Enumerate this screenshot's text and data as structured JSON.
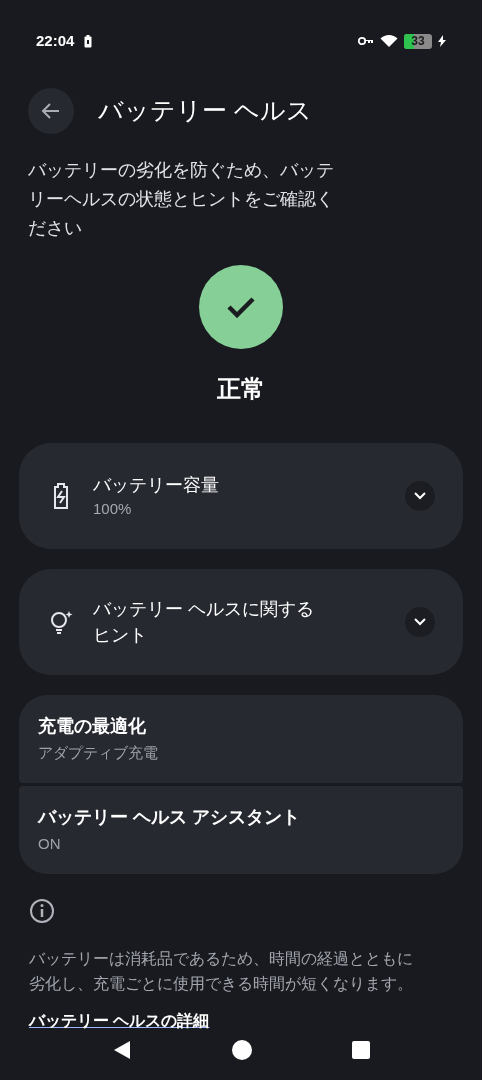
{
  "status_bar": {
    "time": "22:04",
    "battery": "33"
  },
  "header": {
    "title": "バッテリー ヘルス"
  },
  "description": "バッテリーの劣化を防ぐため、バッテリーヘルスの状態とヒントをご確認ください",
  "status": {
    "label": "正常"
  },
  "expandable_cards": [
    {
      "kind": "battery",
      "title": "バッテリー容量",
      "subtitle": "100%",
      "expanded": false
    },
    {
      "kind": "tips",
      "title": "バッテリー ヘルスに関するヒント",
      "expanded": false
    }
  ],
  "settings": [
    {
      "title": "充電の最適化",
      "subtitle": "アダプティブ充電"
    },
    {
      "title": "バッテリー ヘルス アシスタント",
      "subtitle": "ON"
    }
  ],
  "footer": {
    "note": "バッテリーは消耗品であるため、時間の経過とともに劣化し、充電ごとに使用できる時間が短くなります。",
    "link": "バッテリー ヘルスの詳細"
  }
}
